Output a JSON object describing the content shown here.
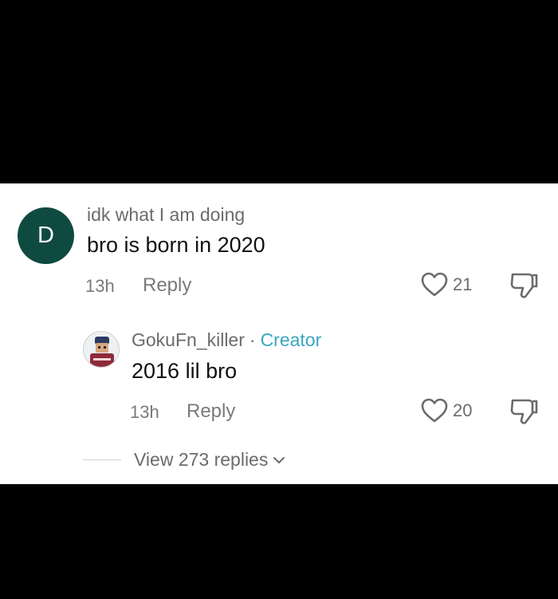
{
  "comment": {
    "avatar_letter": "D",
    "avatar_color": "#0f4a41",
    "username": "idk what I am doing",
    "text": "bro is born in 2020",
    "time": "13h",
    "reply_label": "Reply",
    "likes": "21",
    "like_icon": "heart-outline-icon",
    "dislike_icon": "thumbs-down-icon"
  },
  "reply": {
    "avatar_icon": "roblox-avatar",
    "username": "GokuFn_killer",
    "separator": "·",
    "badge": "Creator",
    "badge_color": "#39a6c2",
    "text": "2016 lil bro",
    "time": "13h",
    "reply_label": "Reply",
    "likes": "20",
    "like_icon": "heart-outline-icon",
    "dislike_icon": "thumbs-down-icon"
  },
  "view_replies": {
    "label": "View 273 replies",
    "icon": "chevron-down-icon"
  }
}
